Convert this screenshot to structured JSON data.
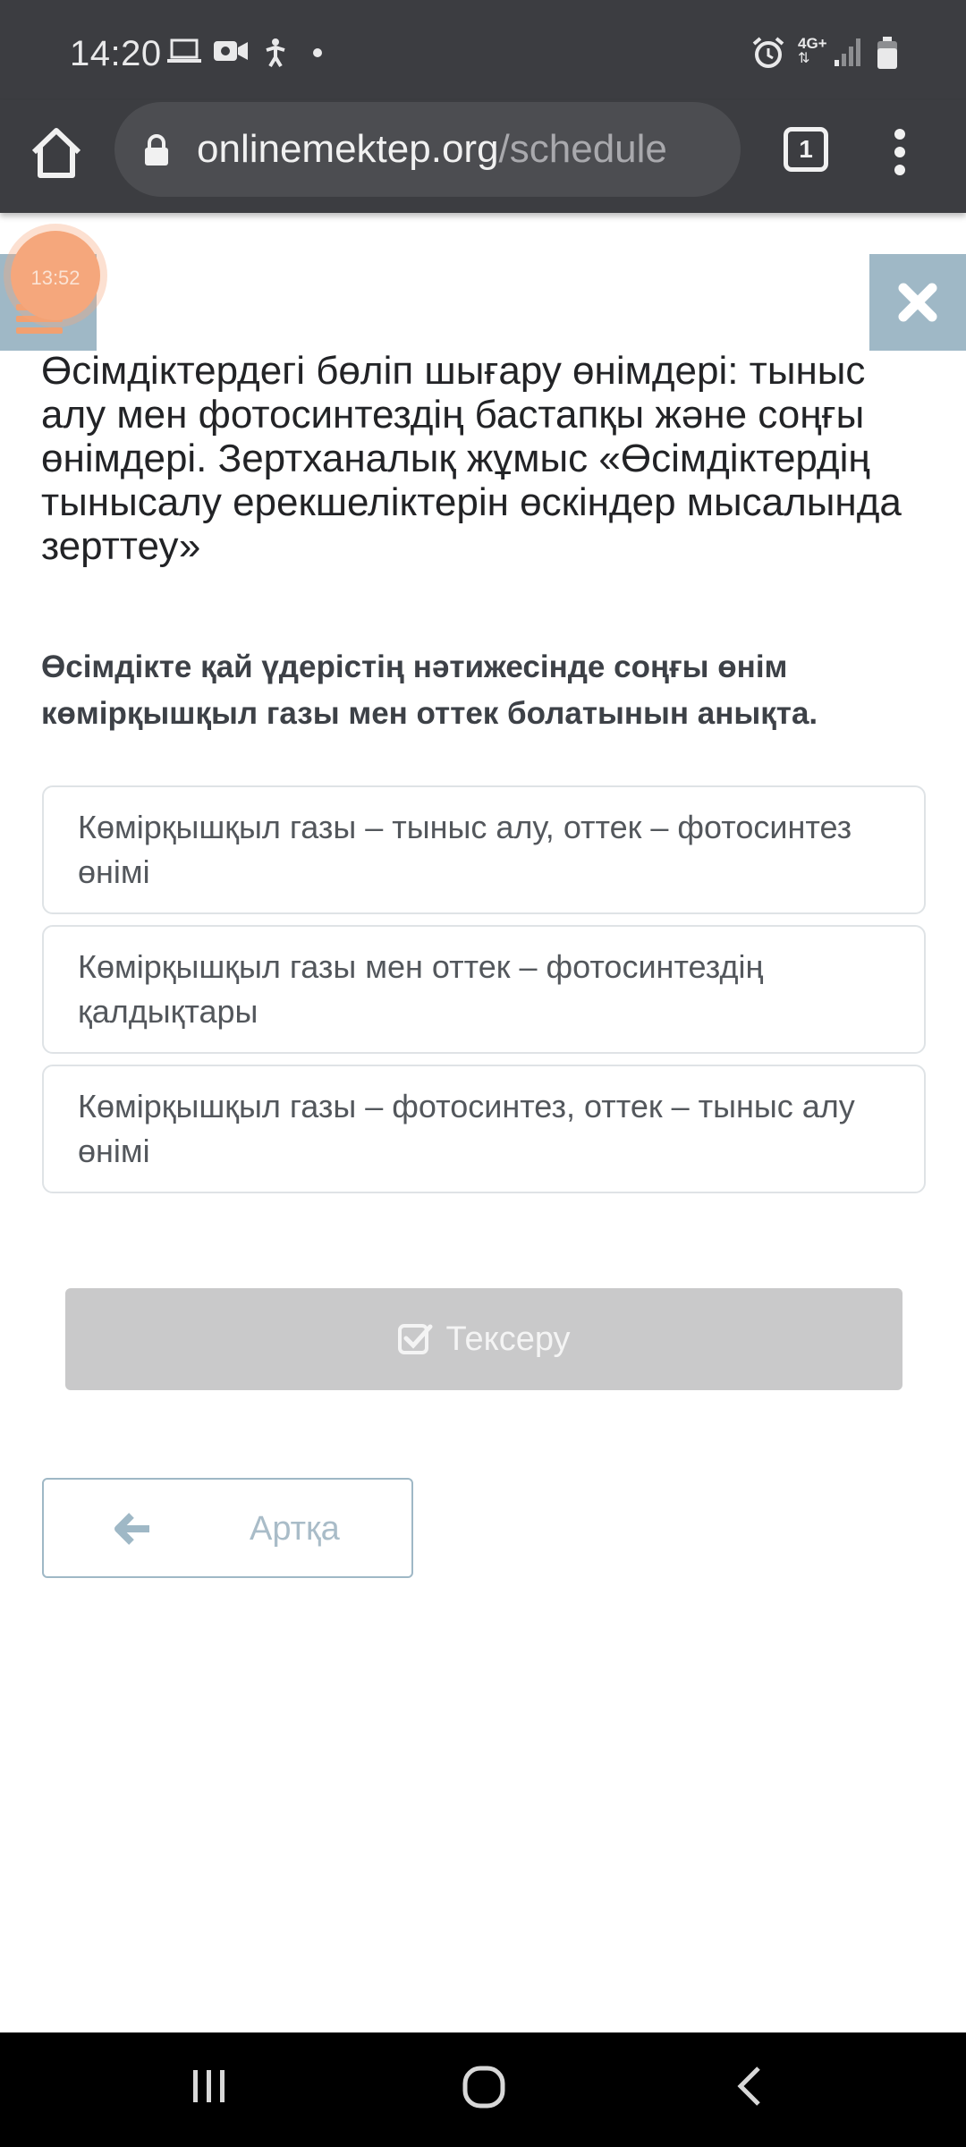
{
  "status_bar": {
    "time": "14:20",
    "left_icons": [
      "laptop-icon",
      "video-camera-icon",
      "accessibility-icon",
      "dot-icon"
    ],
    "right_icons": [
      "alarm-icon",
      "network-4g-icon",
      "signal-icon",
      "battery-icon"
    ],
    "network_label": "4G+"
  },
  "browser": {
    "url_domain": "onlinemektep.org",
    "url_path": "/schedule",
    "tab_count": "1"
  },
  "overlay": {
    "timer": "13:52"
  },
  "lesson": {
    "title": "Өсімдіктердегі бөліп шығару өнімдері: тыныс алу мен фотосинтездің бастапқы және соңғы өнімдері. Зертханалық жұмыс «Өсімдіктердің тынысалу ерекшеліктерін өскіндер мысалында зерттеу»"
  },
  "question": {
    "text": "Өсімдікте қай үдерістің нәтижесінде соңғы өнім көмірқышқыл газы мен оттек болатынын анықта.",
    "options": [
      "Көмірқышқыл газы – тыныс алу, оттек – фотосинтез өнімі",
      "Көмірқышқыл газы мен оттек – фотосинтездің қалдықтары",
      "Көмірқышқыл газы – фотосинтез, оттек – тыныс алу өнімі"
    ]
  },
  "actions": {
    "check_label": "Тексеру",
    "back_label": "Артқа"
  },
  "colors": {
    "status_bg": "#3c3d41",
    "accent_blue_gray": "#9fb8c6",
    "timer_orange": "#f5a77c",
    "disabled_button": "#c9c9ca"
  }
}
